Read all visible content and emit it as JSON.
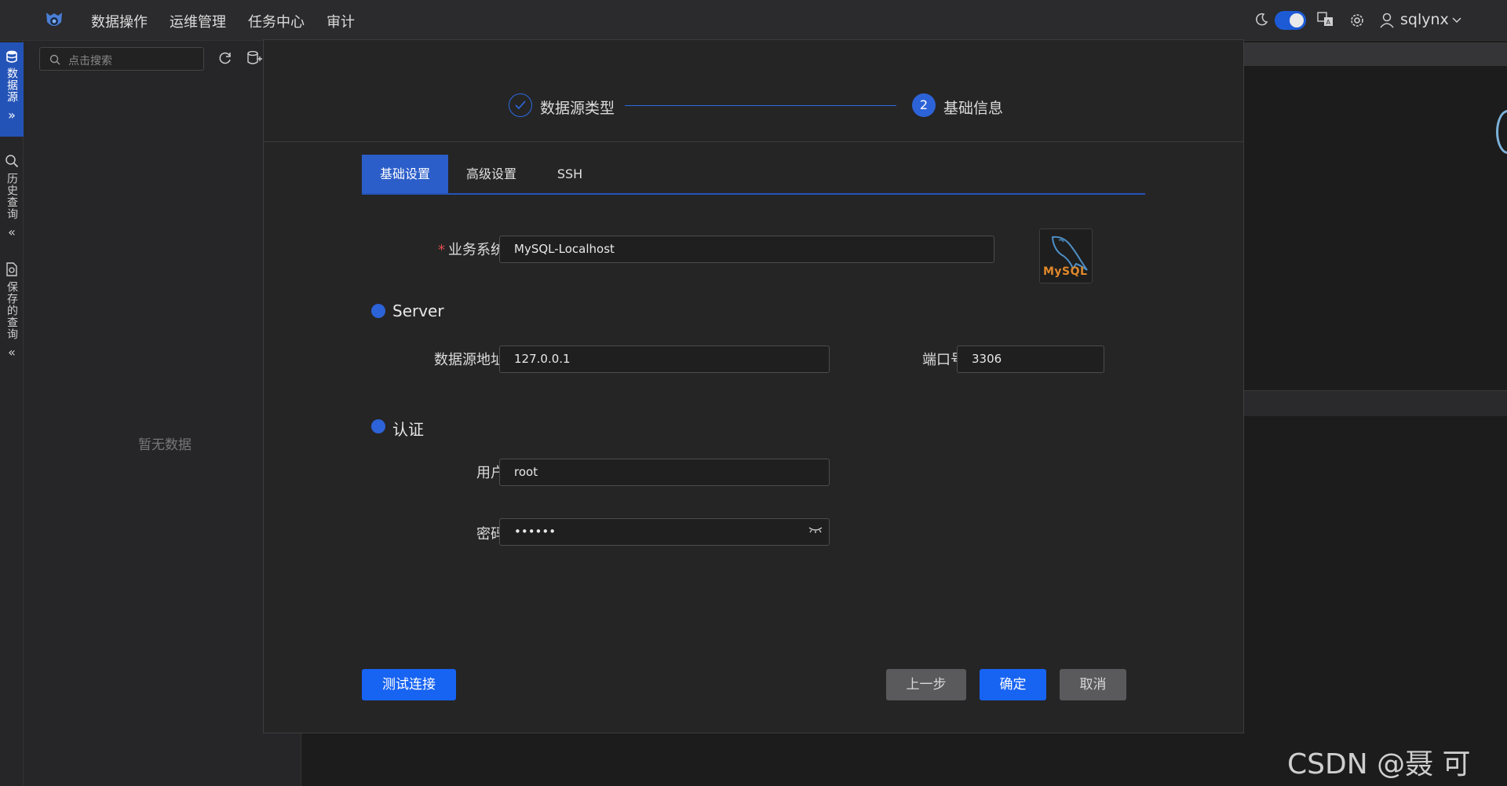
{
  "topbar": {
    "nav": [
      "数据操作",
      "运维管理",
      "任务中心",
      "审计"
    ],
    "user": "sqlynx"
  },
  "rail": {
    "datasource": "数据源",
    "history": "历史查询",
    "saved": "保存的查询"
  },
  "sidepanel": {
    "search_placeholder": "点击搜索",
    "empty": "暂无数据"
  },
  "modal": {
    "steps": [
      {
        "label": "数据源类型",
        "status": "done"
      },
      {
        "label": "基础信息",
        "number": "2",
        "status": "active"
      }
    ],
    "tabs": [
      "基础设置",
      "高级设置",
      "SSH"
    ],
    "form": {
      "business_system_label": "业务系统",
      "business_system_value": "MySQL-Localhost",
      "server_section": "Server",
      "host_label": "数据源地址",
      "host_value": "127.0.0.1",
      "port_label": "端口号",
      "port_value": "3306",
      "auth_section": "认证",
      "user_label": "用户",
      "user_value": "root",
      "password_label": "密码",
      "password_value": "••••••"
    },
    "logo_text": "MySQL",
    "buttons": {
      "test": "测试连接",
      "prev": "上一步",
      "ok": "确定",
      "cancel": "取消"
    }
  },
  "watermark": "CSDN @聂 可 以",
  "colors": {
    "accent": "#1763f2",
    "tab_active": "#2c5ec9",
    "background": "#1f1f1f",
    "modal": "#252526"
  }
}
